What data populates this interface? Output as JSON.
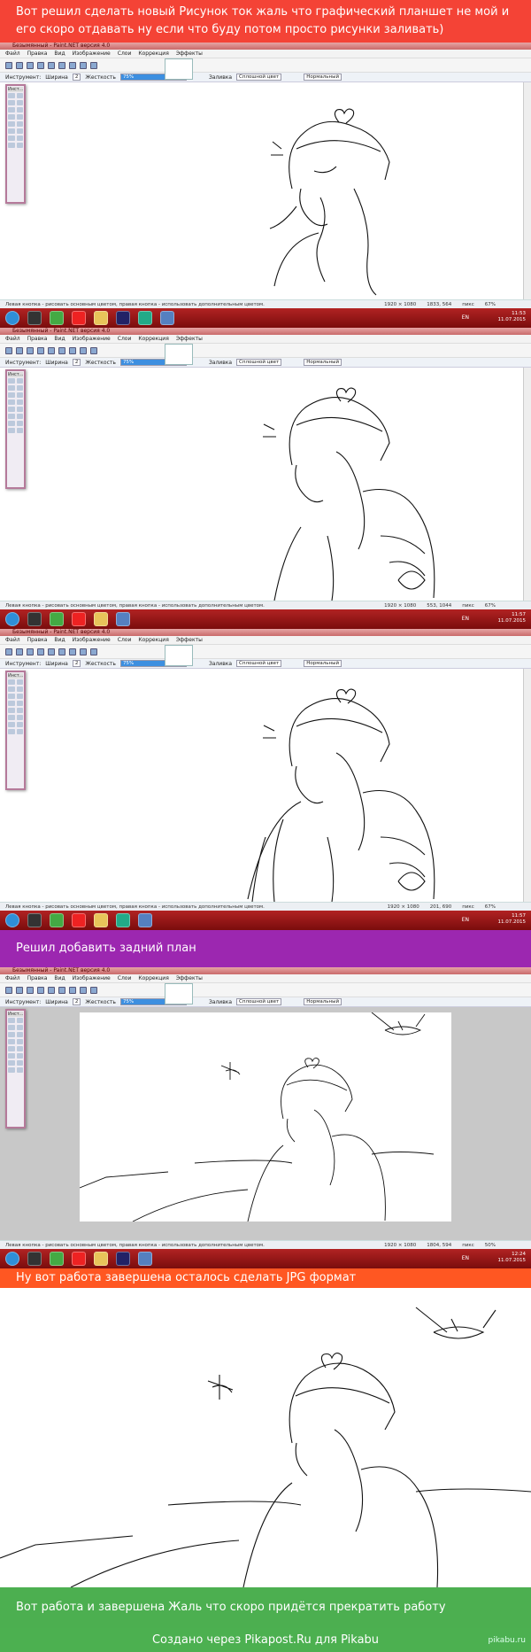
{
  "banners": [
    {
      "text": "Вот решил сделать новый Рисунок ток жаль что графический планшет не мой и его скоро отдавать ну если что буду потом просто рисунки заливать)",
      "color": "#f44336"
    },
    {
      "text": "Решил добавить задний план",
      "color": "#9c27b0"
    },
    {
      "text": "Ну вот работа завершена осталось сделать JPG формат",
      "color": "#ff5722"
    },
    {
      "text": "Вот работа и завершена Жаль что скоро придётся прекратить работу",
      "color": "#4caf50"
    }
  ],
  "app": {
    "title": "Безымянный - Paint.NET версия 4.0",
    "menu": [
      "Файл",
      "Правка",
      "Вид",
      "Изображение",
      "Слои",
      "Коррекция",
      "Эффекты"
    ],
    "toolbar": {
      "tool_label": "Инструмент:",
      "width_label": "Ширина",
      "width_value": "2",
      "hardness_label": "Жесткость",
      "hardness_value": "75%",
      "fill_label": "Заливка",
      "fill_value": "Сплошной цвет",
      "blend_value": "Нормальный"
    },
    "tools_title": "Инст..."
  },
  "screens": [
    {
      "status_hint": "Левая кнопка - рисовать основным цветом, правая кнопка - использовать дополнительным цветом.",
      "size": "1920 × 1080",
      "coords": "1833, 564",
      "units": "пикс",
      "zoom": "67%",
      "clock_time": "11:53",
      "clock_date": "11.07.2015",
      "lang": "EN"
    },
    {
      "status_hint": "Левая кнопка - рисовать основным цветом, правая кнопка - использовать дополнительным цветом.",
      "size": "1920 × 1080",
      "coords": "553, 1044",
      "units": "пикс",
      "zoom": "67%",
      "clock_time": "11:57",
      "clock_date": "11.07.2015",
      "lang": "EN"
    },
    {
      "status_hint": "Левая кнопка - рисовать основным цветом, правая кнопка - использовать дополнительным цветом.",
      "size": "1920 × 1080",
      "coords": "201, 690",
      "units": "пикс",
      "zoom": "67%",
      "clock_time": "11:57",
      "clock_date": "11.07.2015",
      "lang": "EN"
    },
    {
      "status_hint": "Левая кнопка - рисовать основным цветом, правая кнопка - использовать дополнительным цветом.",
      "size": "1920 × 1080",
      "coords": "1804, 594",
      "units": "пикс",
      "zoom": "50%",
      "clock_time": "12:24",
      "clock_date": "11.07.2015",
      "lang": "EN"
    }
  ],
  "footer": {
    "text": "Создано через Pikapost.Ru для Pikabu",
    "logo": "pikabu.ru"
  }
}
